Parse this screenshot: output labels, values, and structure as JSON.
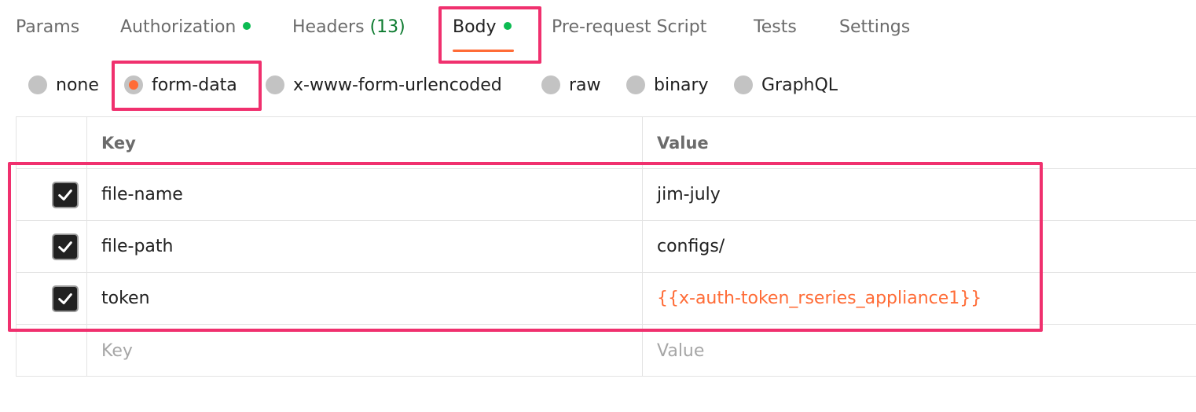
{
  "tabs": [
    {
      "label": "Params"
    },
    {
      "label": "Authorization"
    },
    {
      "label": "Headers",
      "count": "(13)"
    },
    {
      "label": "Body"
    },
    {
      "label": "Pre-request Script"
    },
    {
      "label": "Tests"
    },
    {
      "label": "Settings"
    }
  ],
  "active_tab": "Body",
  "body_types": [
    "none",
    "form-data",
    "x-www-form-urlencoded",
    "raw",
    "binary",
    "GraphQL"
  ],
  "selected_body_type": "form-data",
  "table": {
    "headers": {
      "key": "Key",
      "value": "Value"
    },
    "rows": [
      {
        "checked": true,
        "key": "file-name",
        "value": "jim-july"
      },
      {
        "checked": true,
        "key": "file-path",
        "value": "configs/"
      },
      {
        "checked": true,
        "key": "token",
        "value": "{{x-auth-token_rseries_appliance1}}"
      }
    ],
    "new_row": {
      "key_placeholder": "Key",
      "value_placeholder": "Value"
    }
  },
  "colors": {
    "accent": "#ff6c37",
    "status_dot": "#0cbb52",
    "highlight": "#f0306e"
  }
}
